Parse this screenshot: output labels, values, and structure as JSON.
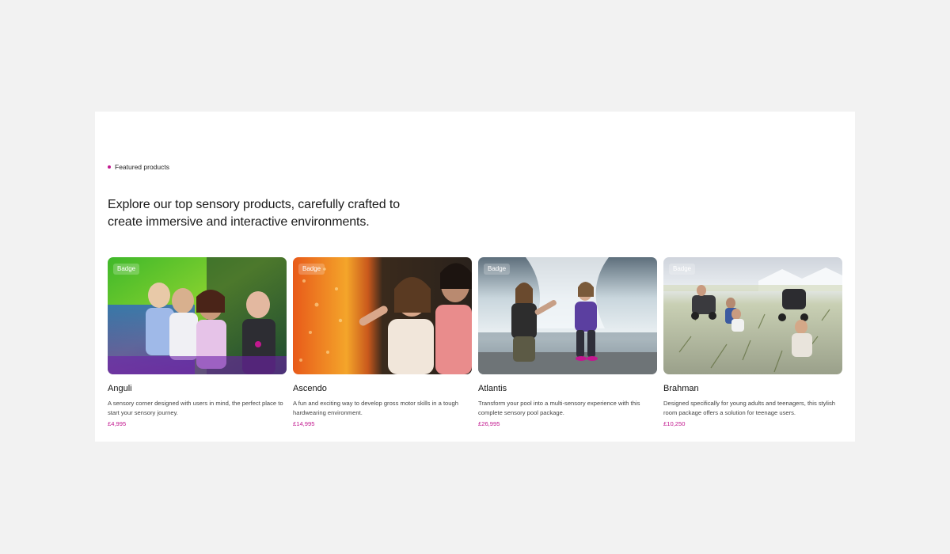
{
  "section": {
    "eyebrow": "Featured products",
    "headline": "Explore our top sensory products, carefully crafted to create immersive and interactive environments."
  },
  "products": [
    {
      "badge": "Badge",
      "name": "Anguli",
      "description": "A sensory corner designed with users in mind, the perfect place to start your sensory journey.",
      "price": "£4,995"
    },
    {
      "badge": "Badge",
      "name": "Ascendo",
      "description": "A fun and exciting way to develop gross motor skills in a tough hardwearing environment.",
      "price": "£14,995"
    },
    {
      "badge": "Badge",
      "name": "Atlantis",
      "description": "Transform your pool into a multi-sensory experience with this complete sensory pool package.",
      "price": "£26,995"
    },
    {
      "badge": "Badge",
      "name": "Brahman",
      "description": "Designed specifically for young adults and teenagers, this stylish room package offers a solution for teenage users.",
      "price": "£10,250"
    }
  ],
  "colors": {
    "accent": "#c2188f",
    "page_background": "#f2f2f2",
    "panel_background": "#ffffff"
  }
}
